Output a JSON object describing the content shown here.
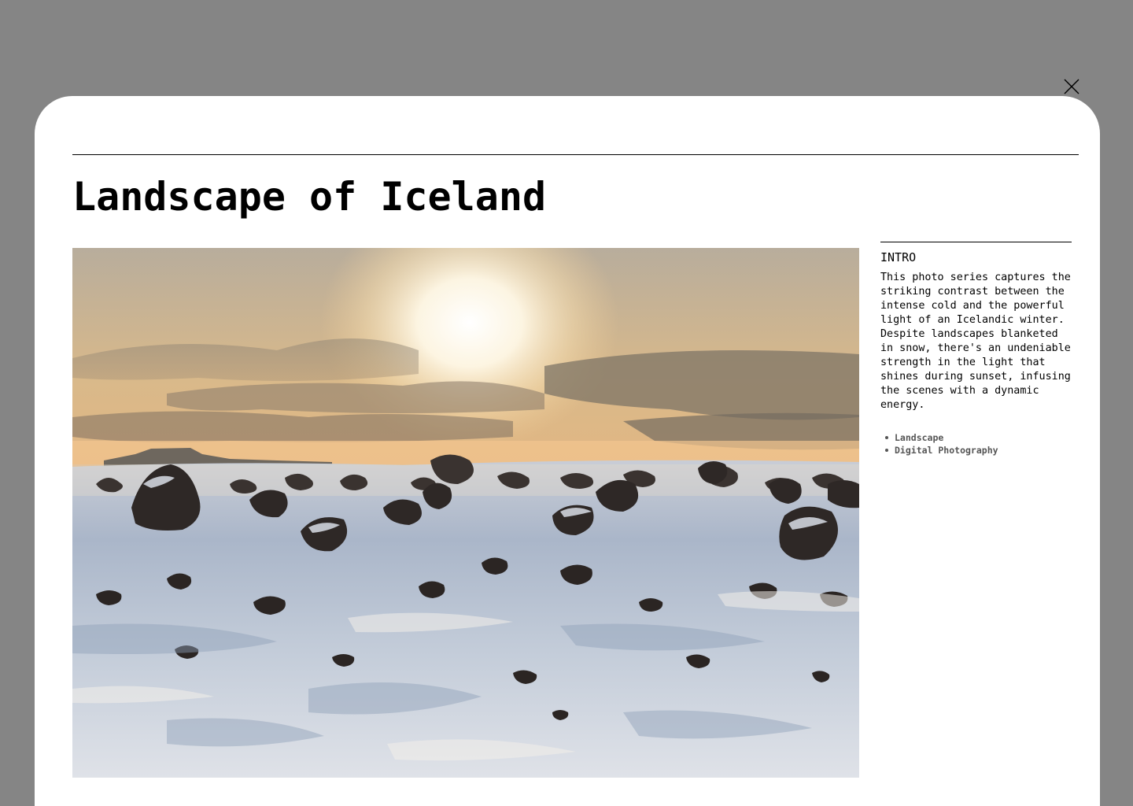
{
  "close_button": {
    "icon": "close-icon"
  },
  "article": {
    "title": "Landscape of Iceland",
    "photo": {
      "alt": "Landscape of Iceland"
    }
  },
  "sidebar": {
    "intro_label": "INTRO",
    "intro_text": "This photo series captures the striking contrast between the intense cold and the powerful light of an Icelandic winter. Despite landscapes blanketed in snow, there's an undeniable strength in the light that shines during sunset, infusing the scenes with a dynamic energy.",
    "tags": [
      "Landscape",
      "Digital Photography"
    ]
  },
  "colors": {
    "overlay": "#858585",
    "modal_bg": "#ffffff",
    "text": "#000000",
    "tag_text": "#555555"
  }
}
